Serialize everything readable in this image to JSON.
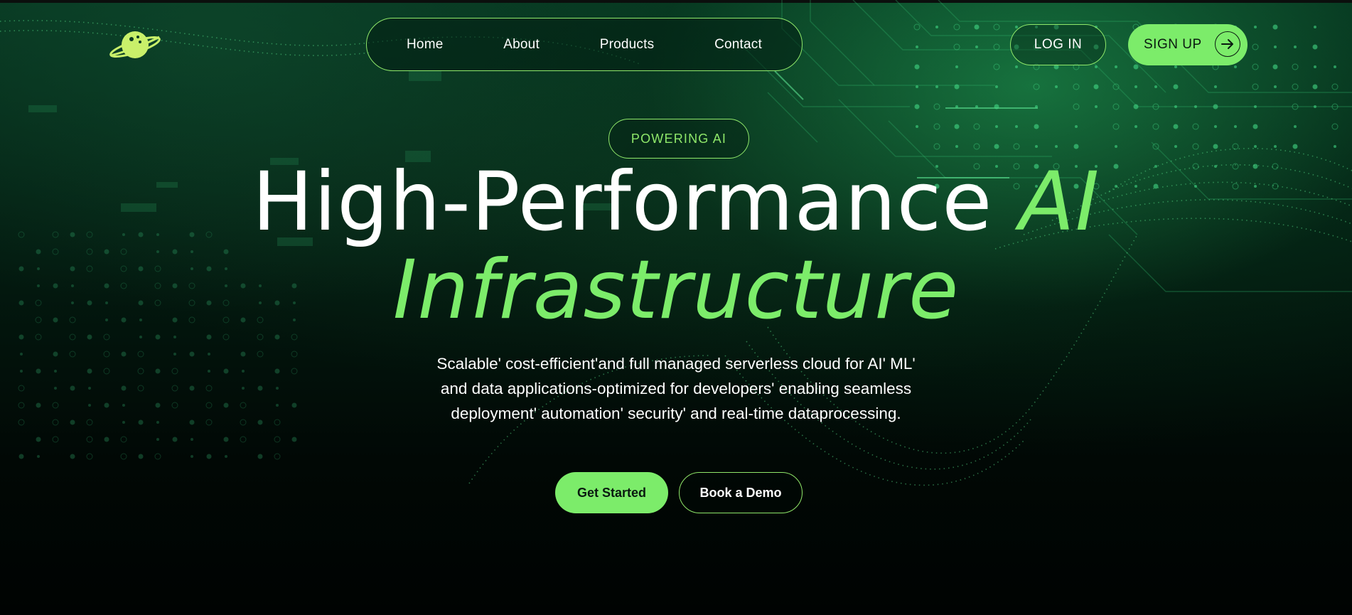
{
  "nav": {
    "logo_icon": "planet-icon",
    "links": [
      {
        "label": "Home"
      },
      {
        "label": "About"
      },
      {
        "label": "Products"
      },
      {
        "label": "Contact"
      }
    ]
  },
  "auth": {
    "login_label": "LOG IN",
    "signup_label": "SIGN UP",
    "signup_icon": "arrow-right-icon"
  },
  "hero": {
    "badge": "POWERING AI",
    "headline_white": "High-Performance",
    "headline_accent_1": "AI",
    "headline_accent_2": "Infrastructure",
    "description": "Scalable' cost-efficient'and full managed serverless cloud for AI' ML' and data applications-optimized for developers' enabling seamless deployment' automation' security' and real-time dataprocessing.",
    "primary_cta": "Get Started",
    "secondary_cta": "Book a Demo"
  },
  "colors": {
    "accent": "#7cec6a",
    "background": "#021a10",
    "text": "#ffffff"
  }
}
